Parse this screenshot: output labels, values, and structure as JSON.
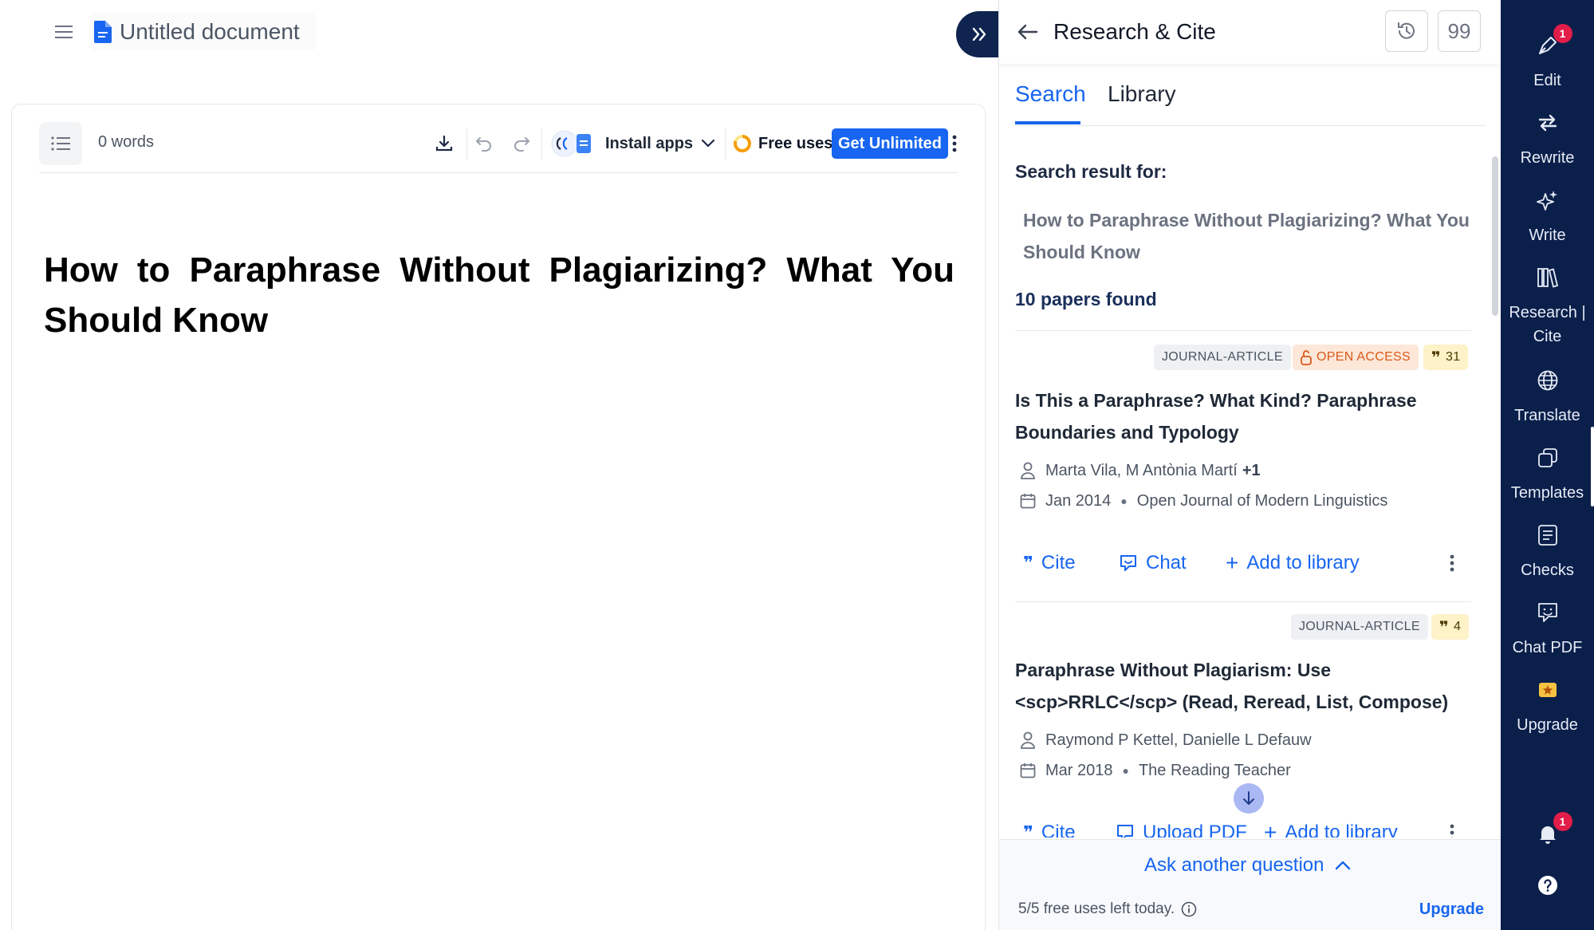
{
  "document": {
    "title": "Untitled document",
    "word_count": "0 words",
    "heading": "How to Paraphrase Without Plagiarizing? What You Should Know"
  },
  "toolbar": {
    "install_apps": "Install apps",
    "free_uses": "Free uses",
    "get_unlimited": "Get Unlimited"
  },
  "panel": {
    "title": "Research & Cite",
    "quote_button": "99",
    "tabs": [
      {
        "label": "Search",
        "active": true
      },
      {
        "label": "Library",
        "active": false
      }
    ],
    "search_result_label": "Search result for:",
    "query": "How to Paraphrase Without Plagiarizing? What You Should Know",
    "papers_found": "10 papers found",
    "papers": [
      {
        "type": "JOURNAL-ARTICLE",
        "open_access": "OPEN ACCESS",
        "citations": "31",
        "title": "Is This a Paraphrase? What Kind? Paraphrase Boundaries and Typology",
        "authors": "Marta Vila, M Antònia Martí",
        "authors_more": "+1",
        "date": "Jan 2014",
        "journal": "Open Journal of Modern Linguistics",
        "actions": [
          "Cite",
          "Chat",
          "Add to library"
        ]
      },
      {
        "type": "JOURNAL-ARTICLE",
        "citations": "4",
        "title": "Paraphrase Without Plagiarism: Use <scp>RRLC</scp> (Read, Reread, List, Compose)",
        "authors": "Raymond P Kettel, Danielle L Defauw",
        "date": "Mar 2018",
        "journal": "The Reading Teacher",
        "actions": [
          "Cite",
          "Upload PDF",
          "Add to library"
        ]
      }
    ],
    "footer": {
      "ask": "Ask another question",
      "uses_left": "5/5 free uses left today.",
      "upgrade": "Upgrade"
    }
  },
  "rail": {
    "items": [
      {
        "label": "Edit",
        "icon": "pen-nib-icon",
        "badge": "1"
      },
      {
        "label": "Rewrite",
        "icon": "rewrite-arrows-icon"
      },
      {
        "label": "Write",
        "icon": "sparkle-icon"
      },
      {
        "label": "Research | Cite",
        "icon": "books-icon"
      },
      {
        "label": "Translate",
        "icon": "globe-icon"
      },
      {
        "label": "Templates",
        "icon": "templates-icon"
      },
      {
        "label": "Checks",
        "icon": "checklist-icon"
      },
      {
        "label": "Chat PDF",
        "icon": "chat-pdf-icon"
      },
      {
        "label": "Upgrade",
        "icon": "upgrade-star-icon"
      }
    ],
    "notifications_badge": "1"
  },
  "colors": {
    "accent": "#1765f0",
    "rail_bg": "#0b1f4b",
    "open_access": "#d9591a",
    "cite_badge": "#fdf2c8"
  }
}
